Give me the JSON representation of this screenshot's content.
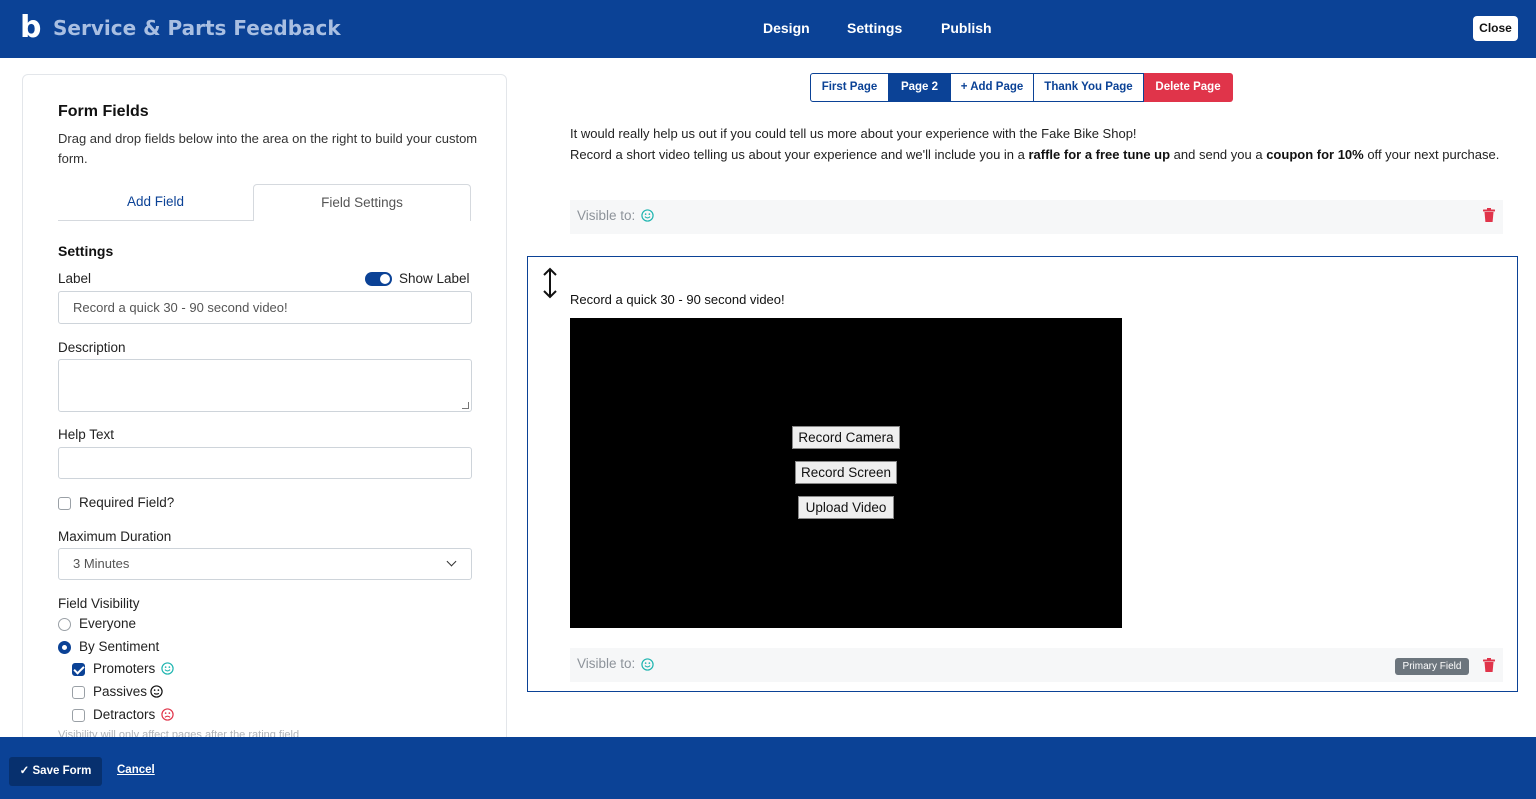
{
  "header": {
    "title": "Service & Parts Feedback",
    "nav": [
      "Design",
      "Settings",
      "Publish"
    ],
    "close_label": "Close"
  },
  "sidebar": {
    "title": "Form Fields",
    "description": "Drag and drop fields below into the area on the right to build your custom form.",
    "tabs": {
      "add": "Add Field",
      "settings": "Field Settings"
    },
    "settings_heading": "Settings",
    "label_label": "Label",
    "show_label": "Show Label",
    "label_value": "Record a quick 30 - 90 second video!",
    "description_label": "Description",
    "help_text_label": "Help Text",
    "required_label": "Required Field?",
    "max_duration_label": "Maximum Duration",
    "max_duration_value": "3 Minutes",
    "visibility_label": "Field Visibility",
    "visibility_options": [
      "Everyone",
      "By Sentiment"
    ],
    "sentiments": [
      "Promoters",
      "Passives",
      "Detractors"
    ],
    "visibility_note": "Visibility will only affect pages after the rating field"
  },
  "page_tabs": {
    "first": "First Page",
    "page2": "Page 2",
    "add": "+ Add Page",
    "thank_you": "Thank You Page",
    "delete": "Delete Page"
  },
  "content": {
    "intro_line1": "It would really help us out if you could tell us more about your experience with the Fake Bike Shop!",
    "intro_line2_a": "Record a short video telling us about your experience and we'll include you in a ",
    "intro_line2_b": "raffle for a free tune up",
    "intro_line2_c": " and send you a ",
    "intro_line2_d": "coupon for 10%",
    "intro_line2_e": " off your next purchase.",
    "visible_to": "Visible to:",
    "field_label": "Record a quick 30 - 90 second video!",
    "video_buttons": [
      "Record Camera",
      "Record Screen",
      "Upload Video"
    ],
    "primary_badge": "Primary Field"
  },
  "footer": {
    "save_label": "Save Form",
    "cancel_label": "Cancel"
  },
  "colors": {
    "primary": "#0b4296",
    "danger": "#e0344a",
    "promoter": "#1fb5b0",
    "detractor": "#e0344a"
  }
}
